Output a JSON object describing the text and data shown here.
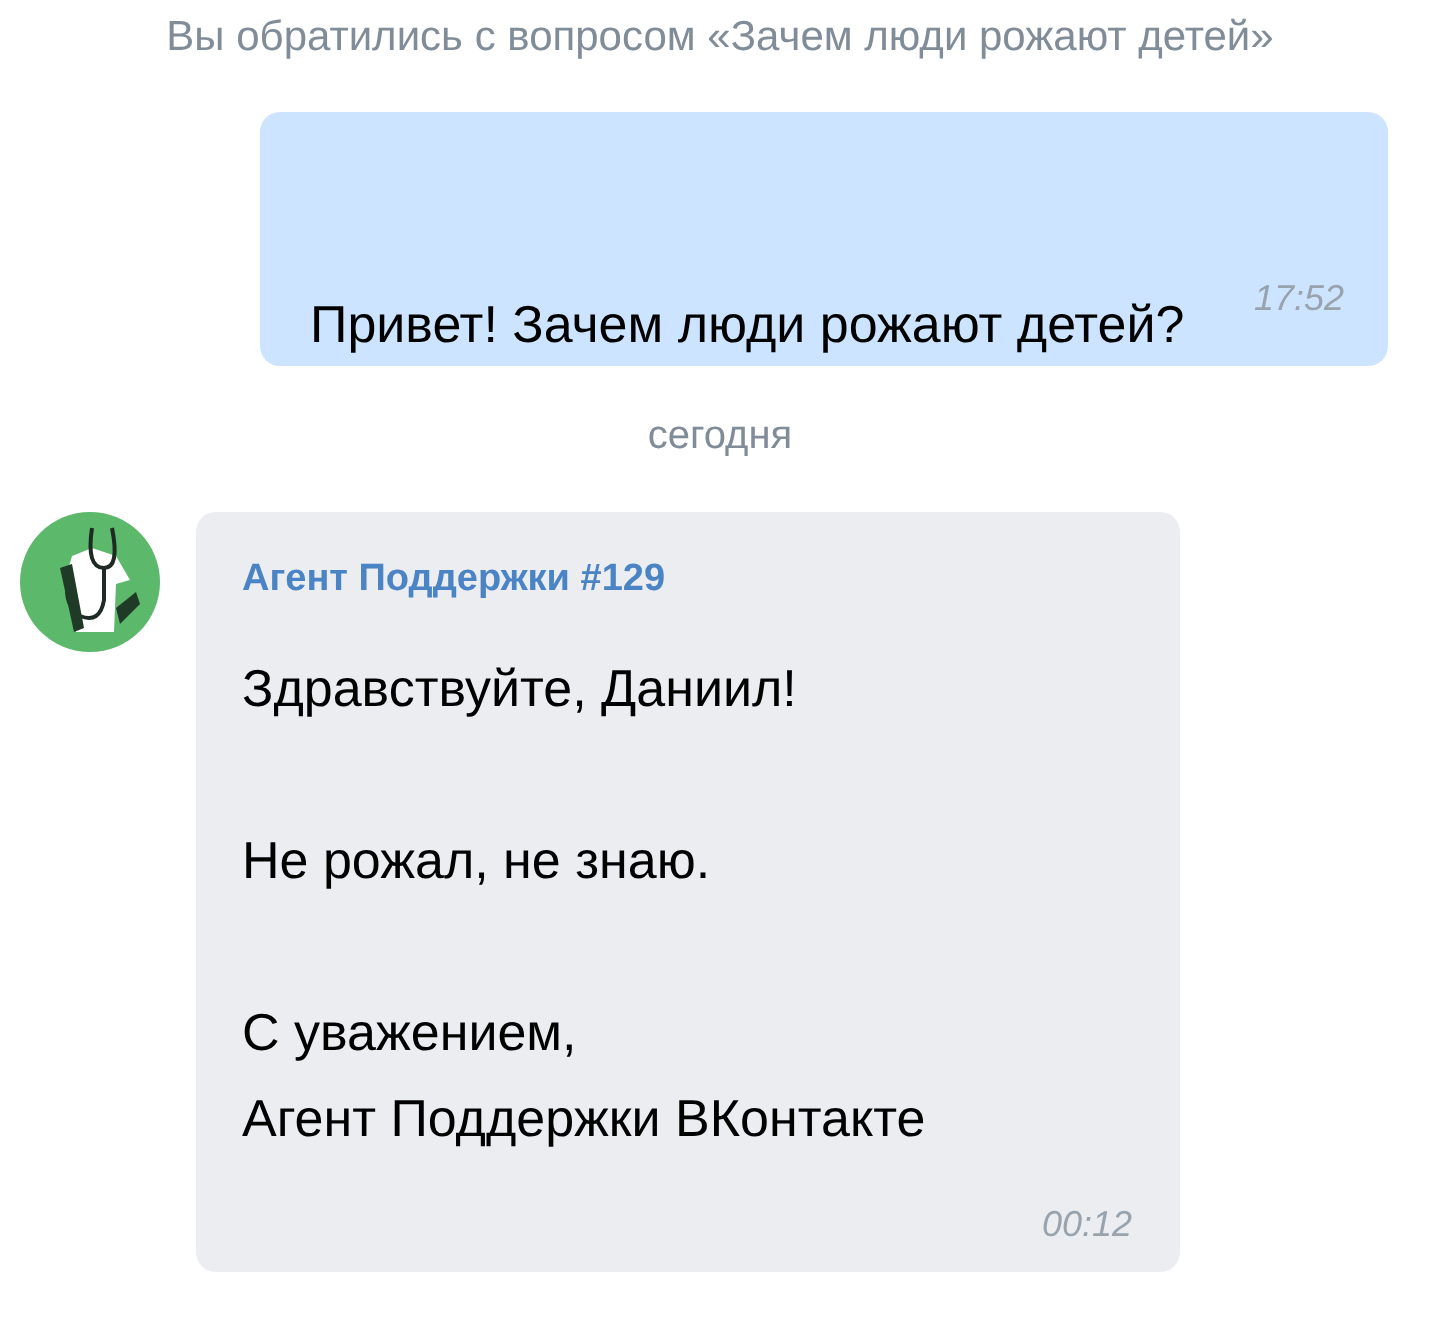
{
  "service_note": "Вы обратились с вопросом «Зачем люди рожают детей»",
  "messages": [
    {
      "kind": "outgoing",
      "text": "Привет! Зачем люди рожают детей?",
      "time": "17:52"
    },
    {
      "kind": "date",
      "text": "сегодня"
    },
    {
      "kind": "incoming",
      "sender": "Агент Поддержки #129",
      "text": "Здравствуйте, Даниил!\n\nНе рожал, не знаю.\n\nС уважением,\nАгент Поддержки ВКонтакте",
      "time": "00:12"
    }
  ]
}
